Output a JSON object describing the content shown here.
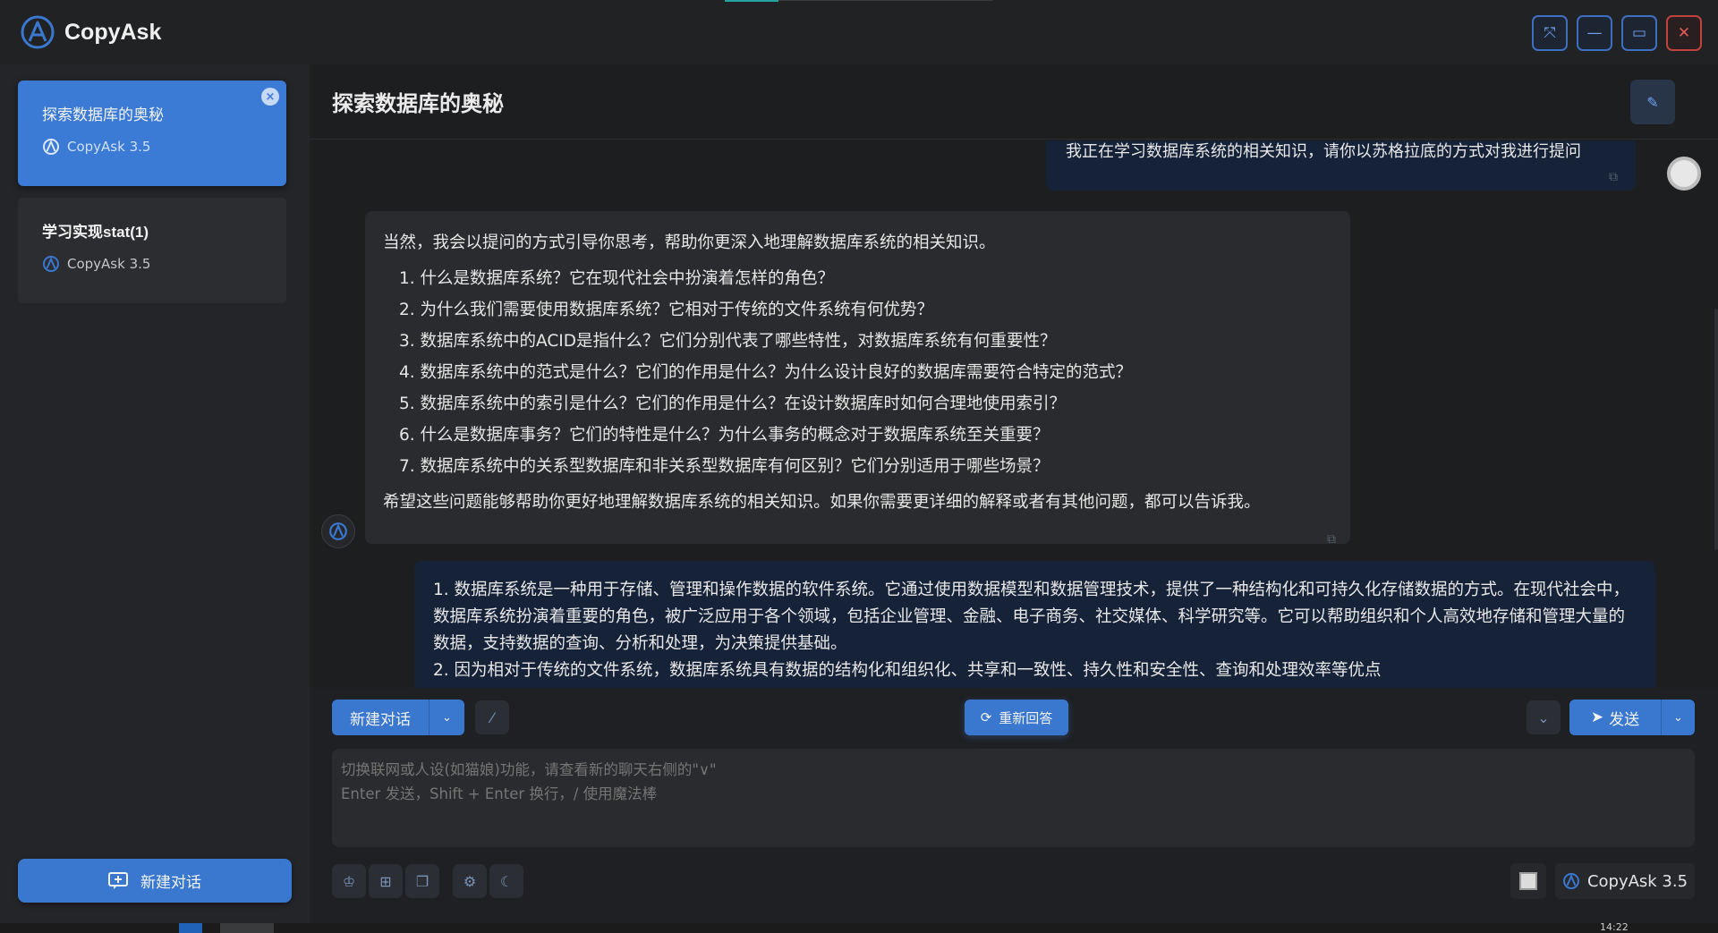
{
  "app": {
    "name": "CopyAsk",
    "accent": "#3a78d0"
  },
  "window_buttons": [
    {
      "name": "pin-icon",
      "glyph": "⤧"
    },
    {
      "name": "minimize-icon",
      "glyph": "—"
    },
    {
      "name": "maximize-icon",
      "glyph": "▭"
    },
    {
      "name": "close-icon",
      "glyph": "✕"
    }
  ],
  "sidebar": {
    "conversations": [
      {
        "title": "探索数据库的奥秘",
        "model": "CopyAsk 3.5",
        "active": true
      },
      {
        "title": "学习实现stat(1)",
        "model": "CopyAsk 3.5",
        "active": false
      }
    ],
    "new_conversation_label": "新建对话"
  },
  "chat": {
    "title": "探索数据库的奥秘",
    "messages": {
      "user1": "我正在学习数据库系统的相关知识，请你以苏格拉底的方式对我进行提问",
      "ai_intro": "当然，我会以提问的方式引导你思考，帮助你更深入地理解数据库系统的相关知识。",
      "ai_items": [
        "1. 什么是数据库系统？它在现代社会中扮演着怎样的角色？",
        "2. 为什么我们需要使用数据库系统？它相对于传统的文件系统有何优势？",
        "3. 数据库系统中的ACID是指什么？它们分别代表了哪些特性，对数据库系统有何重要性？",
        "4. 数据库系统中的范式是什么？它们的作用是什么？为什么设计良好的数据库需要符合特定的范式？",
        "5. 数据库系统中的索引是什么？它们的作用是什么？在设计数据库时如何合理地使用索引？",
        "6. 什么是数据库事务？它们的特性是什么？为什么事务的概念对于数据库系统至关重要？",
        "7. 数据库系统中的关系型数据库和非关系型数据库有何区别？它们分别适用于哪些场景？"
      ],
      "ai_outro": "希望这些问题能够帮助你更好地理解数据库系统的相关知识。如果你需要更详细的解释或者有其他问题，都可以告诉我。",
      "user2_line1": "1. 数据库系统是一种用于存储、管理和操作数据的软件系统。它通过使用数据模型和数据管理技术，提供了一种结构化和可持久化存储数据的方式。在现代社会中，数据库系统扮演着重要的角色，被广泛应用于各个领域，包括企业管理、金融、电子商务、社交媒体、科学研究等。它可以帮助组织和个人高效地存储和管理大量的数据，支持数据的查询、分析和处理，为决策提供基础。",
      "user2_line2": "2. 因为相对于传统的文件系统，数据库系统具有数据的结构化和组织化、共享和一致性、持久性和安全性、查询和处理效率等优点"
    }
  },
  "toolbar": {
    "new_chat_label": "新建对话",
    "regenerate_label": "重新回答",
    "send_label": "发送",
    "input_placeholder": "切换联网或人设(如猫娘)功能，请查看新的聊天右侧的\"∨\"\nEnter 发送，Shift + Enter 换行，/ 使用魔法棒",
    "model_label": "CopyAsk 3.5"
  },
  "taskbar": {
    "time": "14:22"
  }
}
